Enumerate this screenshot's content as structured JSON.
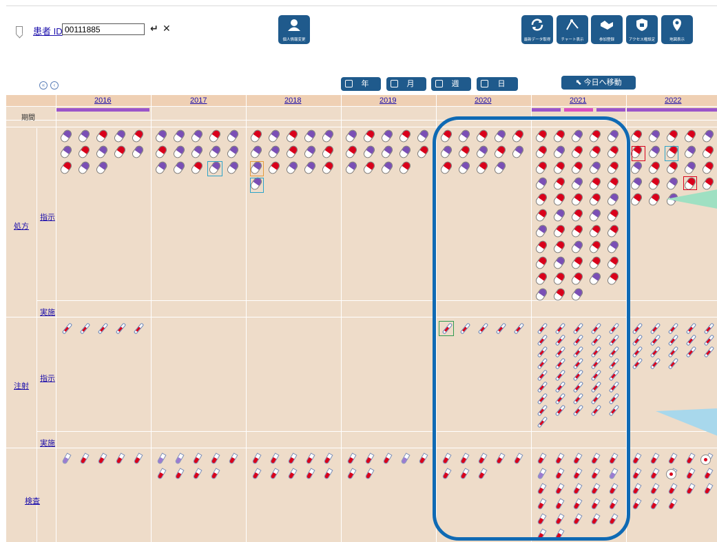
{
  "header": {
    "patient_id_label": "患者 ID",
    "patient_id_value": "00111885",
    "enter_icon": "enter-icon",
    "clear_icon": "close-icon",
    "buttons": [
      {
        "name": "personal-info-button",
        "label": "個人情報変更",
        "icon": "person-card-icon"
      },
      {
        "name": "refresh-data-button",
        "label": "最新データ取得",
        "icon": "refresh-icon"
      },
      {
        "name": "chart-view-button",
        "label": "チャート表示",
        "icon": "chart-line-icon"
      },
      {
        "name": "participation-button",
        "label": "参加登録",
        "icon": "handshake-icon"
      },
      {
        "name": "access-settings-button",
        "label": "アクセス権設定",
        "icon": "lock-icon"
      },
      {
        "name": "map-view-button",
        "label": "地図表示",
        "icon": "map-pin-icon"
      }
    ]
  },
  "nav": {
    "views": [
      "年",
      "月",
      "週",
      "日"
    ],
    "today_label": "今日へ移動"
  },
  "timeline": {
    "years": [
      "2016",
      "2017",
      "2018",
      "2019",
      "2020",
      "2021",
      "2022"
    ],
    "period_label": "期間",
    "categories": [
      {
        "name": "処方",
        "sub": [
          "指示",
          "実施"
        ]
      },
      {
        "name": "注射",
        "sub": [
          "指示",
          "実施"
        ]
      },
      {
        "name": "検査",
        "sub": []
      }
    ]
  },
  "colors": {
    "accent": "#1f5a8c",
    "grid_bg": "#eedcc9",
    "year_header": "#efd0b4",
    "highlight": "#0f6ab4",
    "pill_red": "#d9001b",
    "pill_purple": "#7a4fb5"
  }
}
